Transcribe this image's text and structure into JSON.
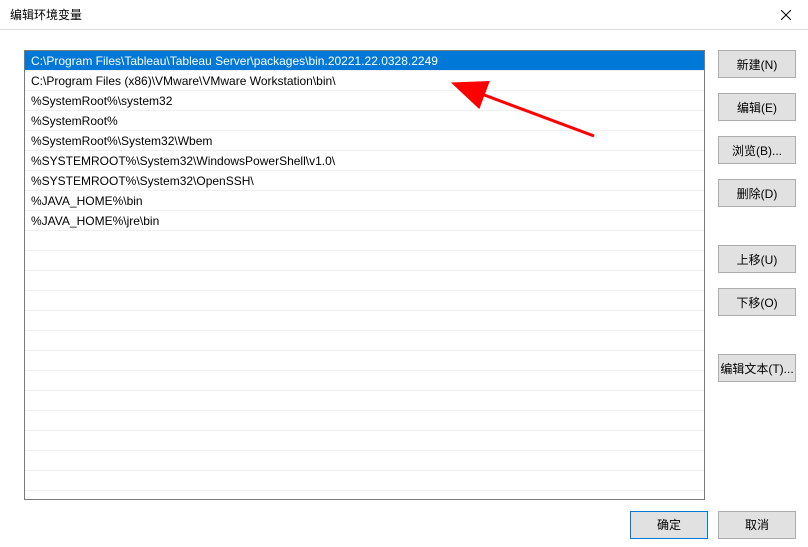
{
  "window": {
    "title": "编辑环境变量"
  },
  "buttons": {
    "new": "新建(N)",
    "edit": "编辑(E)",
    "browse": "浏览(B)...",
    "delete": "删除(D)",
    "moveUp": "上移(U)",
    "moveDown": "下移(O)",
    "editText": "编辑文本(T)...",
    "ok": "确定",
    "cancel": "取消"
  },
  "paths": [
    {
      "value": "C:\\Program Files\\Tableau\\Tableau Server\\packages\\bin.20221.22.0328.2249",
      "selected": true
    },
    {
      "value": "C:\\Program Files (x86)\\VMware\\VMware Workstation\\bin\\",
      "selected": false
    },
    {
      "value": "%SystemRoot%\\system32",
      "selected": false
    },
    {
      "value": "%SystemRoot%",
      "selected": false
    },
    {
      "value": "%SystemRoot%\\System32\\Wbem",
      "selected": false
    },
    {
      "value": "%SYSTEMROOT%\\System32\\WindowsPowerShell\\v1.0\\",
      "selected": false
    },
    {
      "value": "%SYSTEMROOT%\\System32\\OpenSSH\\",
      "selected": false
    },
    {
      "value": "%JAVA_HOME%\\bin",
      "selected": false
    },
    {
      "value": "%JAVA_HOME%\\jre\\bin",
      "selected": false
    }
  ],
  "annotation": {
    "type": "arrow",
    "color": "#ff0000",
    "description": "red arrow pointing to selected first path entry"
  }
}
